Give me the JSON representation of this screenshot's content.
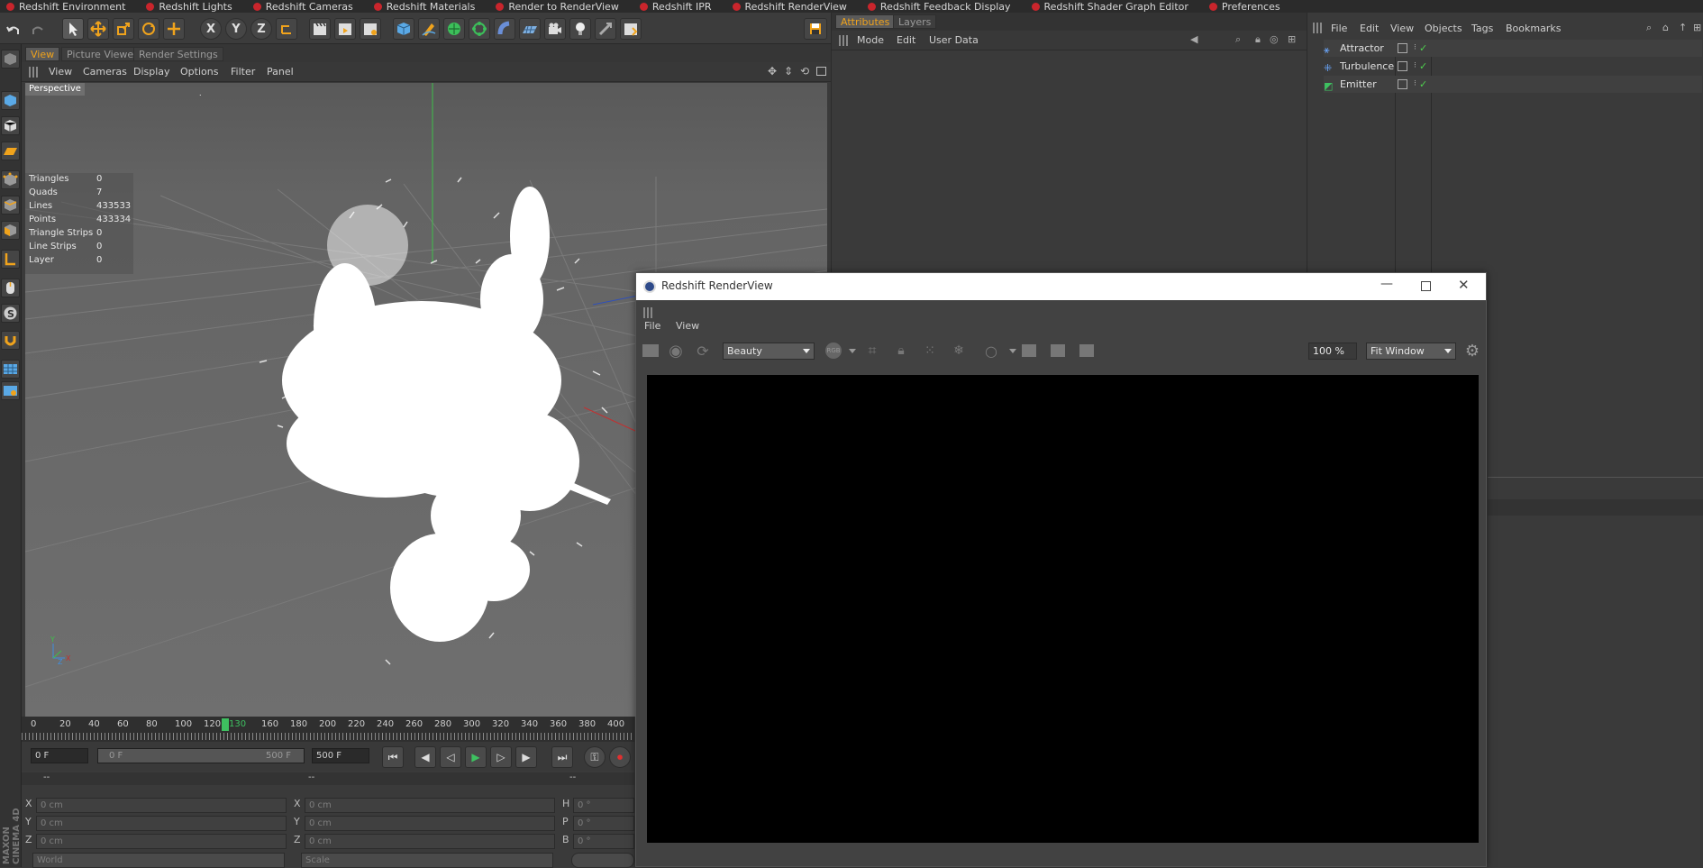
{
  "redshift_menu": [
    "Redshift Environment",
    "Redshift Lights",
    "Redshift Cameras",
    "Redshift Materials",
    "Render to RenderView",
    "Redshift IPR",
    "Redshift RenderView",
    "Redshift Feedback Display",
    "Redshift Shader Graph Editor",
    "Preferences"
  ],
  "toolbar": {
    "axis_x": "X",
    "axis_y": "Y",
    "axis_z": "Z"
  },
  "viewport_tabs": [
    "View",
    "Picture Viewer",
    "Render Settings"
  ],
  "viewport_menu": [
    "View",
    "Cameras",
    "Display",
    "Options",
    "Filter",
    "Panel"
  ],
  "viewport": {
    "label": "Perspective",
    "stats": [
      {
        "label": "Triangles",
        "value": "0"
      },
      {
        "label": "Quads",
        "value": "7"
      },
      {
        "label": "Lines",
        "value": "433533"
      },
      {
        "label": "Points",
        "value": "433334"
      },
      {
        "label": "Triangle Strips",
        "value": "0"
      },
      {
        "label": "Line Strips",
        "value": "0"
      },
      {
        "label": "Layer",
        "value": "0"
      }
    ]
  },
  "timeline": {
    "ticks": [
      "0",
      "20",
      "40",
      "60",
      "80",
      "100",
      "120",
      "130",
      "160",
      "180",
      "200",
      "220",
      "240",
      "260",
      "280",
      "300",
      "320",
      "340",
      "360",
      "380",
      "400"
    ],
    "current": "130"
  },
  "playback": {
    "start_field": "0 F",
    "range_start": "0 F",
    "range_end": "500 F",
    "end_field": "500 F"
  },
  "coords": {
    "header": [
      "--",
      "--",
      "--"
    ],
    "rows": [
      {
        "a": "X",
        "av": "0 cm",
        "b": "X",
        "bv": "0 cm",
        "c": "H",
        "cv": "0 °"
      },
      {
        "a": "Y",
        "av": "0 cm",
        "b": "Y",
        "bv": "0 cm",
        "c": "P",
        "cv": "0 °"
      },
      {
        "a": "Z",
        "av": "0 cm",
        "b": "Z",
        "bv": "0 cm",
        "c": "B",
        "cv": "0 °"
      }
    ],
    "world": "World",
    "scale": "Scale"
  },
  "brand": "MAXON CINEMA 4D",
  "attributes": {
    "tabs": [
      "Attributes",
      "Layers"
    ],
    "menu": [
      "Mode",
      "Edit",
      "User Data"
    ]
  },
  "objects": {
    "menu": [
      "File",
      "Edit",
      "View",
      "Objects",
      "Tags",
      "Bookmarks"
    ],
    "items": [
      "Attractor",
      "Turbulence",
      "Emitter"
    ]
  },
  "renderview": {
    "title": "Redshift RenderView",
    "menu": [
      "File",
      "View"
    ],
    "aov": "Beauty",
    "rgb_label": "RGB",
    "zoom": "100 %",
    "fit": "Fit Window"
  }
}
